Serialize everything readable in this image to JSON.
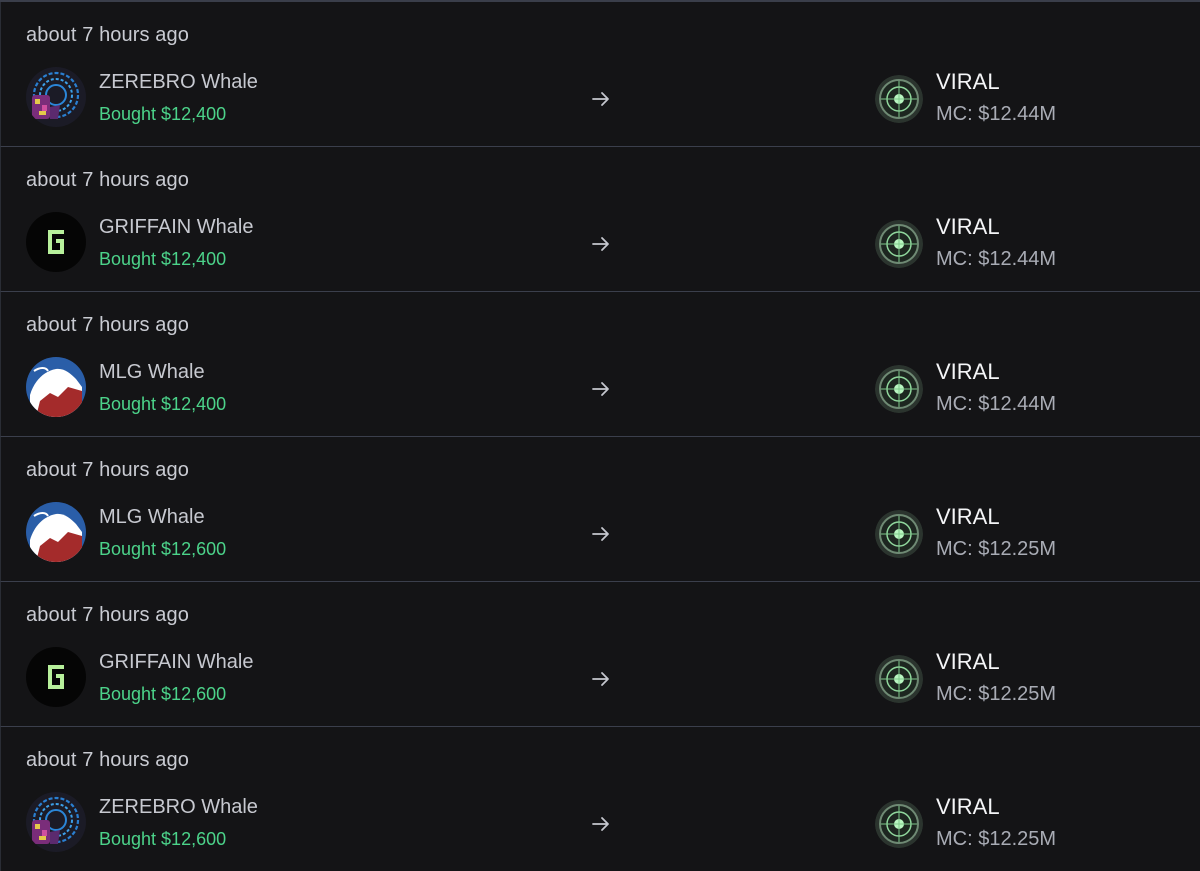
{
  "feed": {
    "rows": [
      {
        "time": "about 7 hours ago",
        "whale": "ZEREBRO Whale",
        "avatar": "zerebro-avatar",
        "bought": "Bought $12,400",
        "token": "VIRAL",
        "mc": "MC: $12.44M"
      },
      {
        "time": "about 7 hours ago",
        "whale": "GRIFFAIN Whale",
        "avatar": "griffain-avatar",
        "bought": "Bought $12,400",
        "token": "VIRAL",
        "mc": "MC: $12.44M"
      },
      {
        "time": "about 7 hours ago",
        "whale": "MLG Whale",
        "avatar": "mlg-avatar",
        "bought": "Bought $12,400",
        "token": "VIRAL",
        "mc": "MC: $12.44M"
      },
      {
        "time": "about 7 hours ago",
        "whale": "MLG Whale",
        "avatar": "mlg-avatar",
        "bought": "Bought $12,600",
        "token": "VIRAL",
        "mc": "MC: $12.25M"
      },
      {
        "time": "about 7 hours ago",
        "whale": "GRIFFAIN Whale",
        "avatar": "griffain-avatar",
        "bought": "Bought $12,600",
        "token": "VIRAL",
        "mc": "MC: $12.25M"
      },
      {
        "time": "about 7 hours ago",
        "whale": "ZEREBRO Whale",
        "avatar": "zerebro-avatar",
        "bought": "Bought $12,600",
        "token": "VIRAL",
        "mc": "MC: $12.25M"
      }
    ],
    "arrow_icon": "arrow-right-icon",
    "token_icon": "viral-token-icon"
  },
  "colors": {
    "background": "#141416",
    "divider": "#3b3f4c",
    "bought_green": "#4cd38a",
    "time_text": "#c9cbd2",
    "token_text": "#f4f5f7",
    "mc_text": "#a9acb5"
  }
}
